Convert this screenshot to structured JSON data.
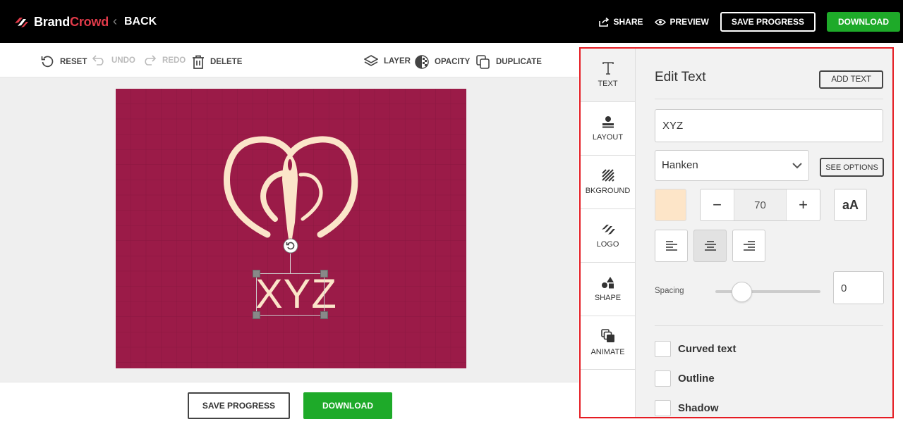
{
  "brand": {
    "name_part1": "Brand",
    "name_part2": "Crowd",
    "accent": "#e23b4a"
  },
  "header": {
    "back_label": "BACK",
    "share_label": "SHARE",
    "preview_label": "PREVIEW",
    "save_progress_label": "SAVE PROGRESS",
    "download_label": "DOWNLOAD",
    "download_color": "#1eaa29"
  },
  "toolbar": {
    "reset_label": "RESET",
    "undo_label": "UNDO",
    "redo_label": "REDO",
    "delete_label": "DELETE",
    "layer_label": "LAYER",
    "opacity_label": "OPACITY",
    "duplicate_label": "DUPLICATE"
  },
  "canvas": {
    "background_color": "#9b1b48",
    "logo_color": "#fbe5c9",
    "logo_text": "XYZ"
  },
  "bottom": {
    "save_progress_label": "SAVE PROGRESS",
    "download_label": "DOWNLOAD"
  },
  "panel": {
    "tabs": [
      {
        "label": "TEXT",
        "icon": "text-icon",
        "active": true
      },
      {
        "label": "LAYOUT",
        "icon": "layout-icon"
      },
      {
        "label": "BKGROUND",
        "icon": "background-icon"
      },
      {
        "label": "LOGO",
        "icon": "logo-icon"
      },
      {
        "label": "SHAPE",
        "icon": "shape-icon"
      },
      {
        "label": "ANIMATE",
        "icon": "animate-icon"
      }
    ],
    "title": "Edit Text",
    "add_text_label": "ADD TEXT",
    "text_value": "XYZ",
    "font_value": "Hanken",
    "see_options_label": "SEE OPTIONS",
    "text_color": "#fde5c8",
    "font_size": "70",
    "minus_label": "−",
    "plus_label": "+",
    "case_label": "aA",
    "alignment_selected": "center",
    "spacing_label": "Spacing",
    "spacing_value": "0",
    "spacing_slider_fraction": 0.25,
    "checkboxes": [
      {
        "label": "Curved text",
        "checked": false
      },
      {
        "label": "Outline",
        "checked": false
      },
      {
        "label": "Shadow",
        "checked": false
      }
    ],
    "highlight_color": "#e51c23"
  }
}
